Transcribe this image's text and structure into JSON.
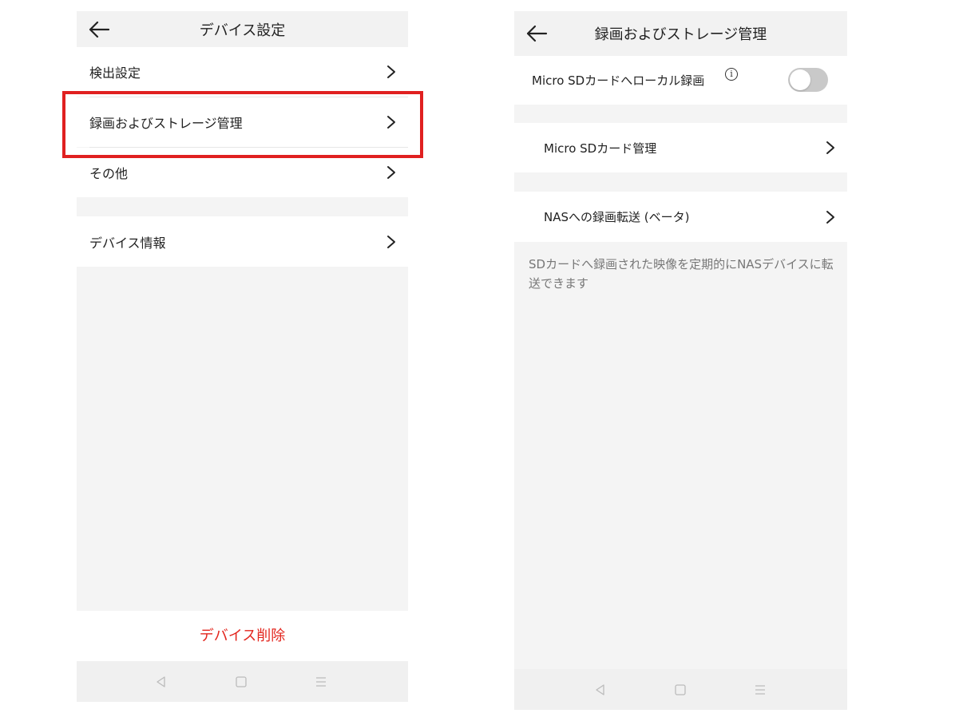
{
  "left": {
    "header": {
      "title": "デバイス設定"
    },
    "items": [
      {
        "label": "検出設定"
      },
      {
        "label": "録画およびストレージ管理"
      },
      {
        "label": "その他"
      },
      {
        "label": "デバイス情報"
      }
    ],
    "delete_label": "デバイス削除"
  },
  "right": {
    "header": {
      "title": "録画およびストレージ管理"
    },
    "local_recording": {
      "label": "Micro SDカードへローカル録画",
      "info_glyph": "i",
      "enabled": false
    },
    "items": [
      {
        "label": "Micro SDカード管理"
      },
      {
        "label": "NASへの録画転送 (ベータ)"
      }
    ],
    "note": "SDカードへ録画された映像を定期的にNASデバイスに転送できます"
  },
  "colors": {
    "highlight": "#e02020",
    "delete_text": "#e3261e",
    "toggle_off": "#c9c9c9",
    "background": "#f4f4f4"
  },
  "icons": {
    "back": "arrow-left-icon",
    "chevron": "chevron-right-icon",
    "nav_back": "triangle-back-icon",
    "nav_home": "square-home-icon",
    "nav_menu": "menu-lines-icon",
    "info": "info-icon"
  }
}
